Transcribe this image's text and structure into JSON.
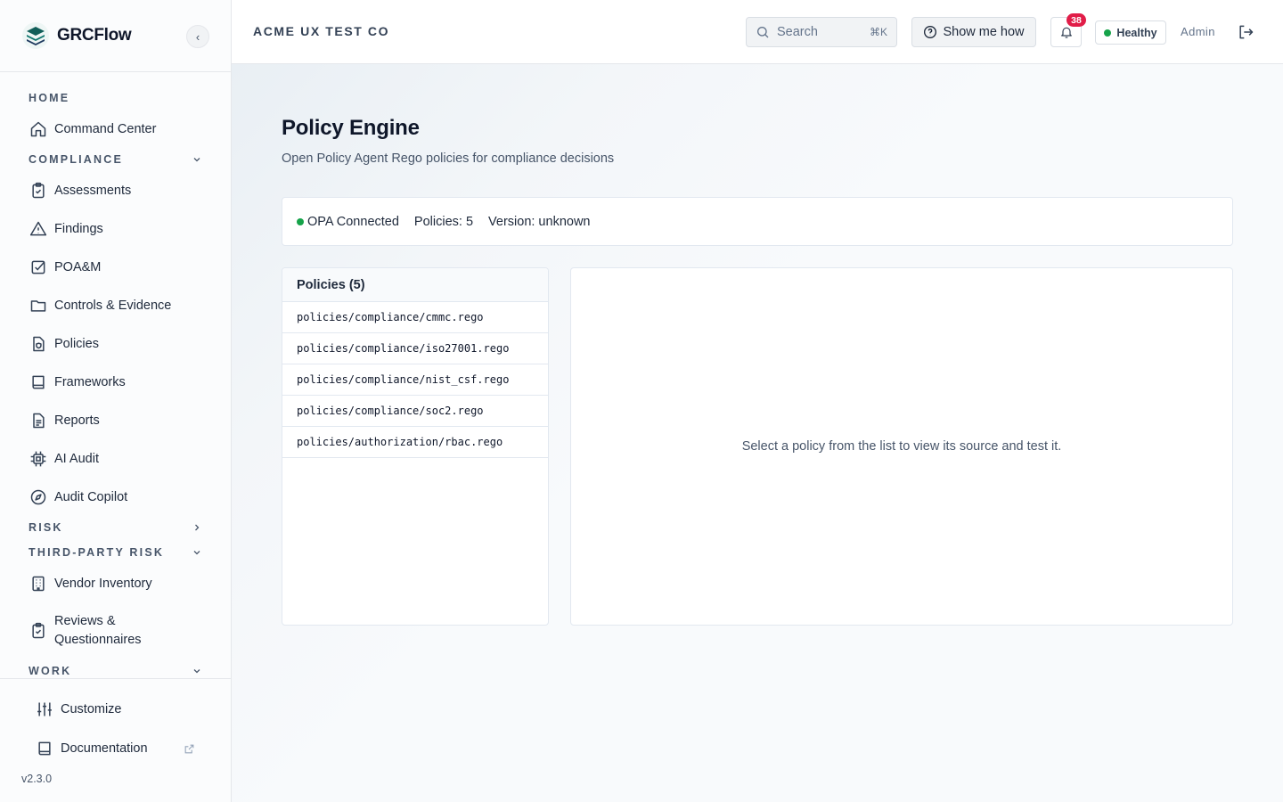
{
  "app": {
    "name": "GRCFlow",
    "version": "v2.3.0"
  },
  "sidebar": {
    "sections": {
      "home": "HOME",
      "compliance": "COMPLIANCE",
      "risk": "RISK",
      "third_party": "THIRD-PARTY RISK",
      "work": "WORK"
    },
    "items": [
      {
        "label": "Command Center",
        "icon": "home-icon"
      },
      {
        "label": "Assessments",
        "icon": "clipboard-check-icon"
      },
      {
        "label": "Findings",
        "icon": "warning-triangle-icon"
      },
      {
        "label": "POA&M",
        "icon": "checkbox-icon"
      },
      {
        "label": "Controls & Evidence",
        "icon": "folder-icon"
      },
      {
        "label": "Policies",
        "icon": "file-shield-icon"
      },
      {
        "label": "Frameworks",
        "icon": "book-icon"
      },
      {
        "label": "Reports",
        "icon": "file-text-icon"
      },
      {
        "label": "AI Audit",
        "icon": "cpu-icon"
      },
      {
        "label": "Audit Copilot",
        "icon": "compass-icon"
      },
      {
        "label": "Vendor Inventory",
        "icon": "building-icon"
      },
      {
        "label": "Reviews & Questionnaires",
        "icon": "clipboard-check-icon"
      }
    ],
    "footer": {
      "customize": "Customize",
      "documentation": "Documentation"
    }
  },
  "header": {
    "org": "ACME UX TEST CO",
    "search_placeholder": "Search",
    "search_shortcut": "⌘K",
    "show_me_how": "Show me how",
    "notification_count": "38",
    "health": "Healthy",
    "user": "Admin"
  },
  "page": {
    "title": "Policy Engine",
    "subtitle": "Open Policy Agent Rego policies for compliance decisions",
    "status": {
      "connection": "OPA Connected",
      "policies": "Policies: 5",
      "version": "Version: unknown"
    },
    "policies_header": "Policies (5)",
    "policies": [
      "policies/compliance/cmmc.rego",
      "policies/compliance/iso27001.rego",
      "policies/compliance/nist_csf.rego",
      "policies/compliance/soc2.rego",
      "policies/authorization/rbac.rego"
    ],
    "empty_state": "Select a policy from the list to view its source and test it."
  },
  "colors": {
    "brand": "#0f766e",
    "healthy": "#16a34a",
    "badge": "#e11d48"
  }
}
